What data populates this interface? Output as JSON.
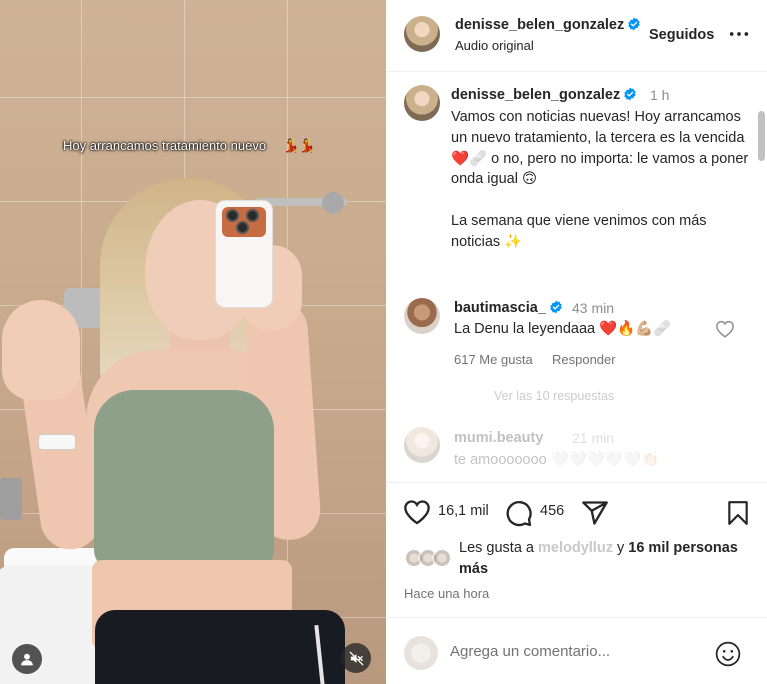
{
  "media": {
    "overlay_caption": "Hoy arrancamos tratamiento nuevo",
    "overlay_emoji": "💃💃",
    "user_button_icon": "user-icon",
    "mute_button_icon": "muted-speaker-icon"
  },
  "header": {
    "username": "denisse_belen_gonzalez",
    "subtitle": "Audio original",
    "follow_label": "Seguidos",
    "more_icon": "more-dots-icon"
  },
  "caption": {
    "username": "denisse_belen_gonzalez",
    "time": "1 h",
    "lines": [
      "Vamos con noticias nuevas! Hoy arrancamos un nuevo tratamiento, la tercera es la vencida ❤️🩹 o no, pero no importa: le vamos a poner onda igual 🙃",
      "",
      "La semana que viene venimos con más noticias ✨"
    ]
  },
  "comment_1": {
    "username": "bautimascia_",
    "time": "43 min",
    "text": "La Denu la leyendaaa ❤️🔥💪🏼🩹",
    "likes": "617 Me gusta",
    "reply_label": "Responder"
  },
  "view_replies": "Ver las 10 respuestas",
  "comment_2": {
    "username": "mumi.beauty",
    "time": "21 min",
    "text": "te amooooooo 🤍🤍🤍🤍🤍👏🏻"
  },
  "actions": {
    "like_count": "16,1 mil",
    "comment_count": "456",
    "icons": [
      "heart-icon",
      "comment-icon",
      "share-icon",
      "bookmark-icon"
    ]
  },
  "likes": {
    "prefix": "Les gusta a",
    "user": "melodylluz",
    "connector": "y",
    "others": "16 mil personas más"
  },
  "timestamp": "Hace una hora",
  "add_comment": {
    "placeholder": "Agrega un comentario...",
    "emoji_icon": "smiley-icon"
  },
  "colors": {
    "verified": "#0095f6",
    "text": "#262626",
    "muted": "#737373",
    "heart_red": "#e0245e"
  }
}
